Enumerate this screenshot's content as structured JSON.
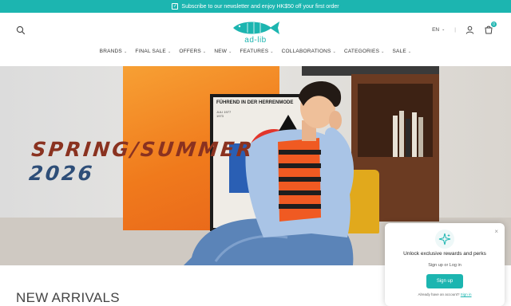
{
  "announcement": {
    "text": "Subscribe to our newsletter and enjoy HK$50 off your first order"
  },
  "header": {
    "logo_text": "ad-lib",
    "language": "EN",
    "separator": "|",
    "cart_count": "0"
  },
  "nav": {
    "items": [
      {
        "label": "BRANDS"
      },
      {
        "label": "FINAL SALE"
      },
      {
        "label": "OFFERS"
      },
      {
        "label": "NEW"
      },
      {
        "label": "FEATURES"
      },
      {
        "label": "COLLABORATIONS"
      },
      {
        "label": "CATEGORIES"
      },
      {
        "label": "SALE"
      }
    ]
  },
  "hero": {
    "line1": "SPRING/SUMMER",
    "line2": "2026",
    "poster_title": "FÜHREND IN DER HERRENMODE",
    "poster_date_1": "JULI 1977",
    "poster_date_2": "1973"
  },
  "section": {
    "title": "NEW ARRIVALS"
  },
  "popup": {
    "close": "×",
    "title": "Unlock exclusive rewards and perks",
    "subtitle": "Sign up or Log in",
    "button": "Sign up",
    "footer_prefix": "Already have an account?",
    "footer_link": "Sign in"
  },
  "colors": {
    "accent": "#1cb5b0",
    "hero_red": "#8a3220",
    "hero_blue": "#2e4e78",
    "orange": "#f07a1c"
  }
}
